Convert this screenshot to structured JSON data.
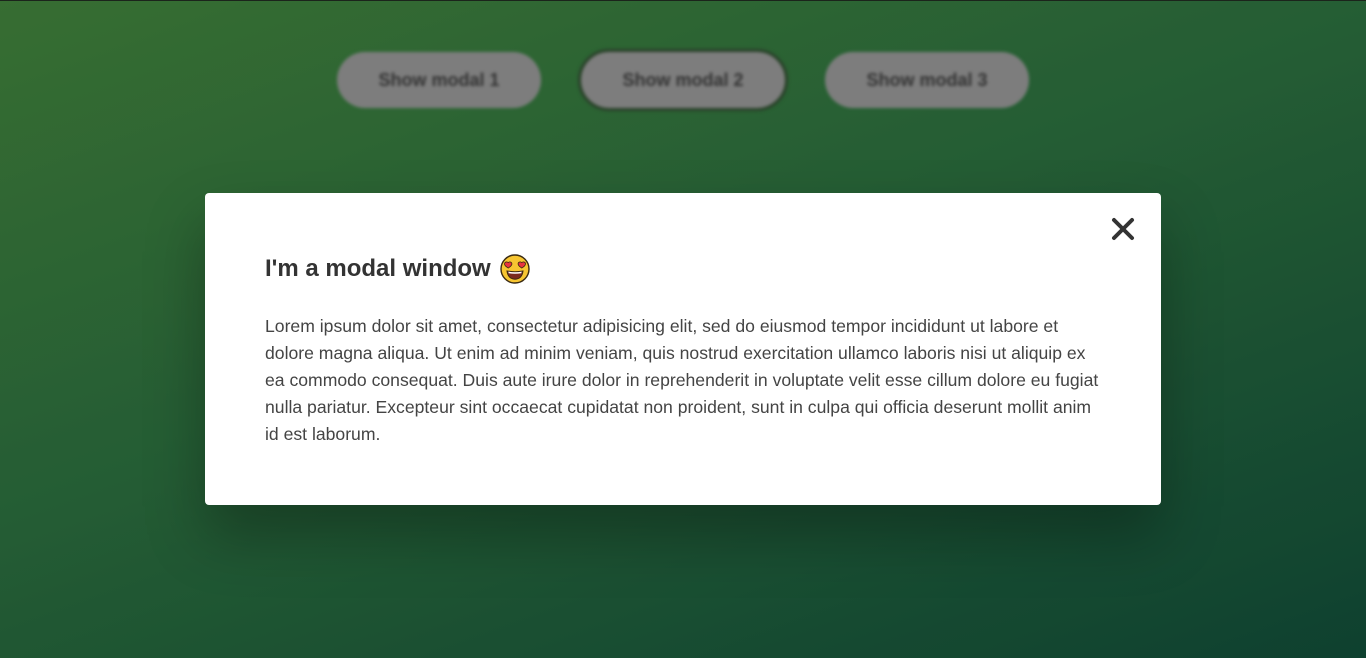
{
  "buttons": [
    {
      "label": "Show modal 1"
    },
    {
      "label": "Show modal 2"
    },
    {
      "label": "Show modal 3"
    }
  ],
  "modal": {
    "title": "I'm a modal window",
    "emoji_icon": "heart-eyes-emoji-icon",
    "close_icon": "close-icon",
    "body": "Lorem ipsum dolor sit amet, consectetur adipisicing elit, sed do eiusmod tempor incididunt ut labore et dolore magna aliqua. Ut enim ad minim veniam, quis nostrud exercitation ullamco laboris nisi ut aliquip ex ea commodo consequat. Duis aute irure dolor in reprehenderit in voluptate velit esse cillum dolore eu fugiat nulla pariatur. Excepteur sint occaecat cupidatat non proident, sunt in culpa qui officia deserunt mollit anim id est laborum."
  },
  "colors": {
    "background_start": "#3f7d3a",
    "background_end": "#114a36",
    "button_bg": "#8f8f8f",
    "modal_bg": "#ffffff",
    "title_text": "#333333",
    "body_text": "#444444"
  }
}
